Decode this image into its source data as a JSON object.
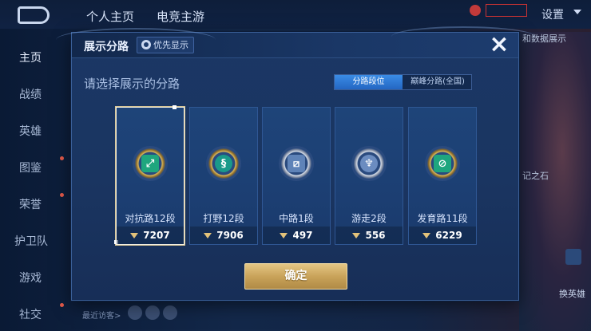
{
  "top_bar": {
    "tabs": [
      "个人主页",
      "电竞主游"
    ],
    "settings_label": "设置"
  },
  "sidebar": {
    "items": [
      {
        "label": "主页",
        "active": true
      },
      {
        "label": "战绩"
      },
      {
        "label": "英雄"
      },
      {
        "label": "图鉴"
      },
      {
        "label": "荣誉"
      },
      {
        "label": "护卫队"
      },
      {
        "label": "游戏"
      },
      {
        "label": "社交"
      }
    ]
  },
  "right_panel": {
    "label_data": "和数据展示",
    "label_stone": "记之石",
    "hero_button": "换英雄"
  },
  "bottom": {
    "recent_visitors": "最近访客>"
  },
  "modal": {
    "title": "展示分路",
    "priority_chip": "优先显示",
    "close_icon": "×",
    "subtitle": "请选择展示的分路",
    "segments": [
      {
        "label": "分路段位",
        "active": true
      },
      {
        "label": "巅峰分路(全国)",
        "active": false
      }
    ],
    "cards": [
      {
        "label": "对抗路12段",
        "value": "7207",
        "icon": "sword-shield-icon",
        "ring": "gold",
        "selected": true
      },
      {
        "label": "打野12段",
        "value": "7906",
        "icon": "dragon-icon",
        "ring": "gold",
        "selected": false
      },
      {
        "label": "中路1段",
        "value": "497",
        "icon": "slash-icon",
        "ring": "silver",
        "selected": false
      },
      {
        "label": "游走2段",
        "value": "556",
        "icon": "wings-icon",
        "ring": "silver",
        "selected": false
      },
      {
        "label": "发育路11段",
        "value": "6229",
        "icon": "target-icon",
        "ring": "gold",
        "selected": false
      }
    ],
    "confirm_label": "确定"
  },
  "colors": {
    "accent_blue": "#2f7ed8",
    "gold": "#d8b55a",
    "modal_bg": "#1b3765"
  }
}
